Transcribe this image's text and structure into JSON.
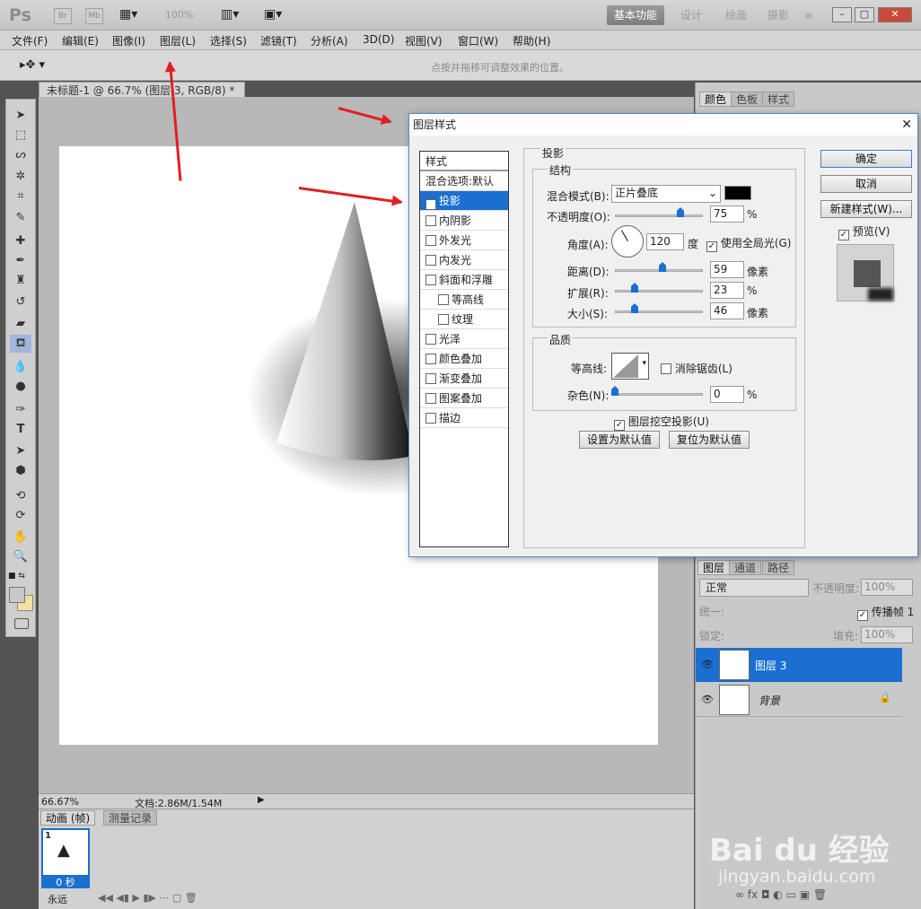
{
  "app": {
    "logo": "Ps",
    "br": "Br",
    "mb": "Mb",
    "zoom": "100%",
    "workspaces": [
      "基本功能",
      "设计",
      "绘画",
      "摄影"
    ],
    "more": "»"
  },
  "menu": [
    "文件(F)",
    "编辑(E)",
    "图像(I)",
    "图层(L)",
    "选择(S)",
    "滤镜(T)",
    "分析(A)",
    "3D(D)",
    "视图(V)",
    "窗口(W)",
    "帮助(H)"
  ],
  "options": {
    "hint": "点按并拖移可调整效果的位置。"
  },
  "document": {
    "tab": "未标题-1 @ 66.7% (图层 3, RGB/8) *",
    "zoom": "66.67%",
    "doc": "文档:2.86M/1.54M"
  },
  "anim": {
    "tabs": [
      "动画 (帧)",
      "测量记录"
    ],
    "frame_num": "1",
    "frame_time": "0 秒",
    "loop": "永远"
  },
  "panels": {
    "top_tabs": [
      "颜色",
      "色板",
      "样式"
    ],
    "layer_tabs": [
      "图层",
      "通道",
      "路径"
    ],
    "blend": "正常",
    "opacity_label": "不透明度:",
    "opacity": "100%",
    "unify": "统一:",
    "propagate": "传播帧 1",
    "lock": "锁定:",
    "fill_label": "填充:",
    "fill": "100%",
    "layers": [
      {
        "name": "图层 3",
        "selected": true
      },
      {
        "name": "背景",
        "selected": false
      }
    ]
  },
  "dialog": {
    "title": "图层样式",
    "styles_header": "样式",
    "blend_default": "混合选项:默认",
    "styles": [
      {
        "label": "投影",
        "checked": true
      },
      {
        "label": "内阴影",
        "checked": false
      },
      {
        "label": "外发光",
        "checked": false
      },
      {
        "label": "内发光",
        "checked": false
      },
      {
        "label": "斜面和浮雕",
        "checked": false
      },
      {
        "label": "等高线",
        "checked": false,
        "indent": true
      },
      {
        "label": "纹理",
        "checked": false,
        "indent": true
      },
      {
        "label": "光泽",
        "checked": false
      },
      {
        "label": "颜色叠加",
        "checked": false
      },
      {
        "label": "渐变叠加",
        "checked": false
      },
      {
        "label": "图案叠加",
        "checked": false
      },
      {
        "label": "描边",
        "checked": false
      }
    ],
    "section": "投影",
    "structure": "结构",
    "blend_mode_label": "混合模式(B):",
    "blend_mode": "正片叠底",
    "opacity_label": "不透明度(O):",
    "opacity": "75",
    "pct": "%",
    "angle_label": "角度(A):",
    "angle": "120",
    "deg": "度",
    "global_light": "使用全局光(G)",
    "distance_label": "距离(D):",
    "distance": "59",
    "px": "像素",
    "spread_label": "扩展(R):",
    "spread": "23",
    "size_label": "大小(S):",
    "size": "46",
    "quality": "品质",
    "contour_label": "等高线:",
    "antialias": "消除锯齿(L)",
    "noise_label": "杂色(N):",
    "noise": "0",
    "knockout": "图层挖空投影(U)",
    "make_default": "设置为默认值",
    "reset_default": "复位为默认值",
    "ok": "确定",
    "cancel": "取消",
    "new_style": "新建样式(W)...",
    "preview": "预览(V)",
    "shadow_color": "#000000"
  },
  "watermark": {
    "brand": "Bai du 经验",
    "url": "jingyan.baidu.com"
  }
}
